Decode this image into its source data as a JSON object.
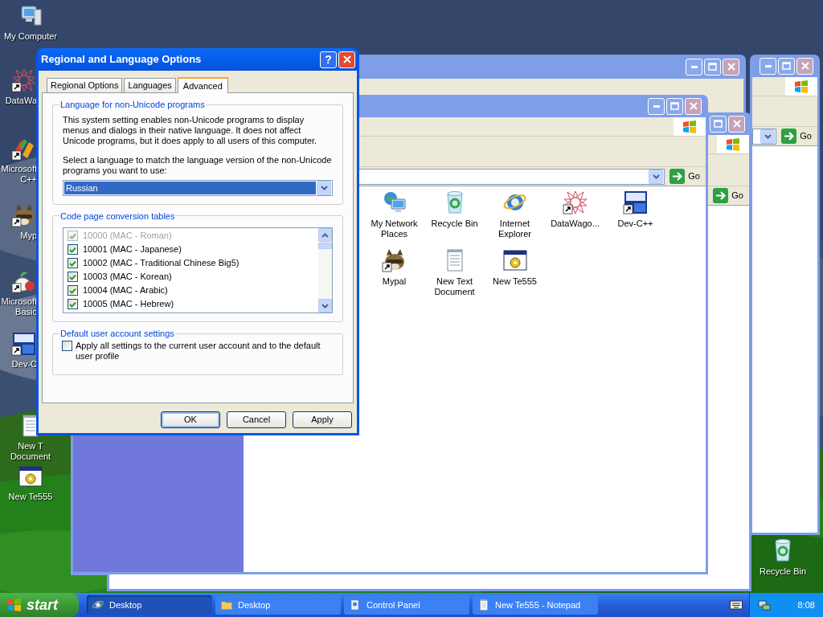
{
  "desktop_icons": [
    {
      "kind": "computer",
      "label": "My Computer",
      "shortcut": false
    },
    {
      "kind": "starburst",
      "label": "DataWa",
      "shortcut": true
    },
    {
      "kind": "blocks",
      "label": "Microsoft C++",
      "shortcut": true
    },
    {
      "kind": "raccoon",
      "label": "Myp",
      "shortcut": true
    },
    {
      "kind": "fruit",
      "label": "Microsoft Basic",
      "shortcut": true
    },
    {
      "kind": "dev",
      "label": "Dev-C",
      "shortcut": true
    },
    {
      "kind": "document",
      "label": "New T Document",
      "shortcut": false
    },
    {
      "kind": "app",
      "label": "New Te555",
      "shortcut": false
    }
  ],
  "desktop_icons_right": [
    {
      "kind": "recycle",
      "label": "Recycle Bin",
      "shortcut": false
    }
  ],
  "explorer_windows": [
    {
      "go_label": "Go"
    },
    {
      "go_label": "Go"
    },
    {
      "go_label": "Go",
      "items": [
        {
          "kind": "network",
          "label": "My Network Places",
          "shortcut": false
        },
        {
          "kind": "recycle",
          "label": "Recycle Bin",
          "shortcut": false
        },
        {
          "kind": "orb",
          "label": "Internet Explorer",
          "shortcut": false
        },
        {
          "kind": "starburst",
          "label": "DataWago...",
          "shortcut": true
        },
        {
          "kind": "dev",
          "label": "Dev-C++",
          "shortcut": true
        },
        {
          "kind": "raccoon",
          "label": "Mypal",
          "shortcut": true
        },
        {
          "kind": "document",
          "label": "New Text Document",
          "shortcut": false
        },
        {
          "kind": "app",
          "label": "New Te555",
          "shortcut": false
        }
      ]
    }
  ],
  "dialog": {
    "title": "Regional and Language Options",
    "help_glyph": "?",
    "tabs": [
      {
        "label": "Regional Options",
        "selected": false
      },
      {
        "label": "Languages",
        "selected": false
      },
      {
        "label": "Advanced",
        "selected": true
      }
    ],
    "language_group": {
      "legend": "Language for non-Unicode programs",
      "description": "This system setting enables non-Unicode programs to display menus and dialogs in their native language. It does not affect Unicode programs, but it does apply to all users of this computer.",
      "prompt": "Select a language to match the language version of the non-Unicode programs you want to use:",
      "language": "Russian"
    },
    "code_page_group": {
      "legend": "Code page conversion tables",
      "items": [
        {
          "label": "10000 (MAC - Roman)",
          "checked": true,
          "disabled": true
        },
        {
          "label": "10001 (MAC - Japanese)",
          "checked": true,
          "disabled": false
        },
        {
          "label": "10002 (MAC - Traditional Chinese Big5)",
          "checked": true,
          "disabled": false
        },
        {
          "label": "10003 (MAC - Korean)",
          "checked": true,
          "disabled": false
        },
        {
          "label": "10004 (MAC - Arabic)",
          "checked": true,
          "disabled": false
        },
        {
          "label": "10005 (MAC - Hebrew)",
          "checked": true,
          "disabled": false
        }
      ]
    },
    "account_group": {
      "legend": "Default user account settings",
      "label": "Apply all settings to the current user account and to the default user profile",
      "checked": false
    },
    "buttons": [
      {
        "label": "OK",
        "selected": true
      },
      {
        "label": "Cancel",
        "selected": false
      },
      {
        "label": "Apply",
        "selected": false
      }
    ]
  },
  "taskbar": {
    "start_label": "start",
    "tasks": [
      {
        "kind": "orb",
        "label": "Desktop",
        "selected": true
      },
      {
        "kind": "folder",
        "label": "Desktop",
        "selected": false
      },
      {
        "kind": "control",
        "label": "Control Panel",
        "selected": false
      },
      {
        "kind": "notepad",
        "label": "New Te555 - Notepad",
        "selected": false
      }
    ],
    "clock": "8:08"
  }
}
